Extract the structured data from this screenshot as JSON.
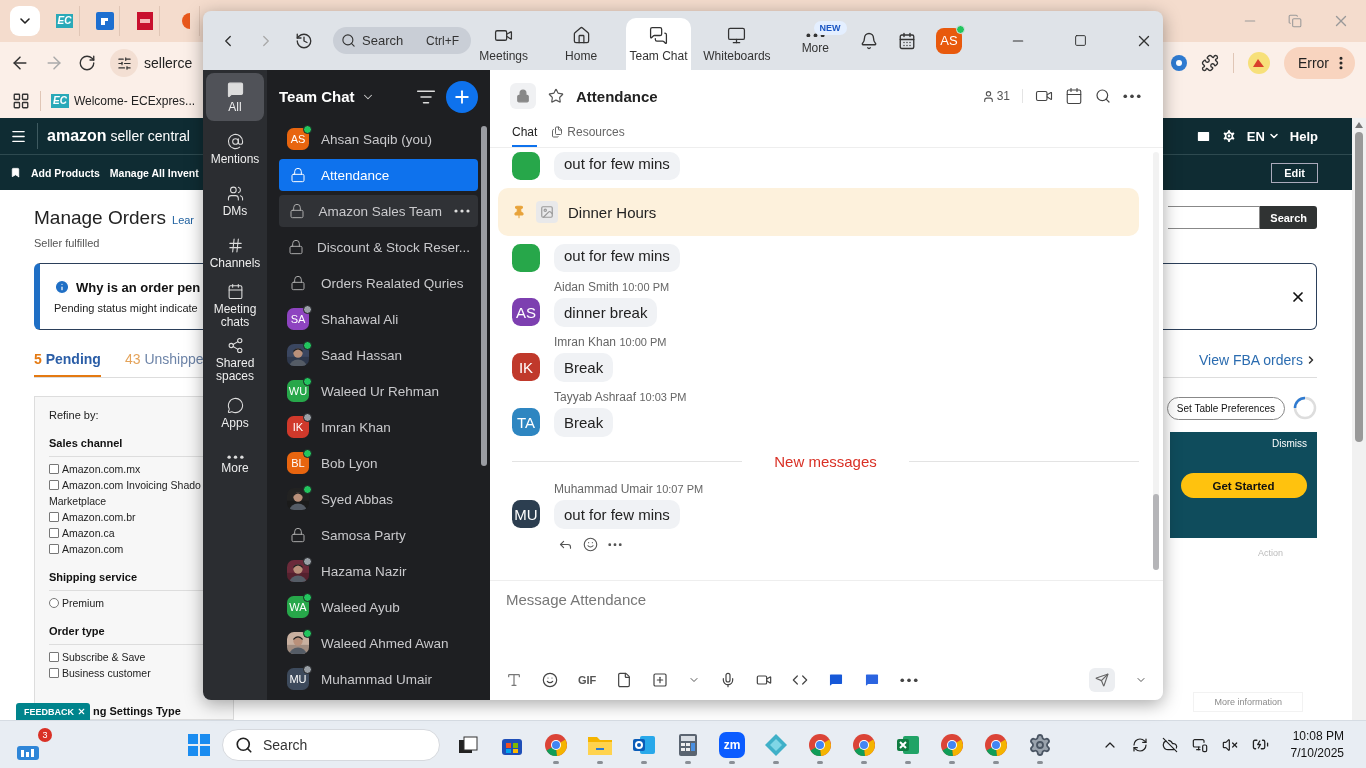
{
  "browser": {
    "tabs": [
      {
        "kind": "ec",
        "label": "EC"
      },
      {
        "kind": "blue"
      },
      {
        "kind": "red"
      },
      {
        "kind": "orange"
      }
    ],
    "address": "sellerce",
    "error_button": "Error",
    "bookmark": {
      "icon": "EC",
      "label": "Welcome- ECExpres..."
    }
  },
  "amazon": {
    "logo": "**amazon** seller central",
    "lang": "EN",
    "help": "Help",
    "subnav": [
      "Add Products",
      "Manage All Invent"
    ],
    "edit": "Edit",
    "title": "Manage Orders",
    "learn": "Lear",
    "subtitle": "Seller fulfilled",
    "search_button": "Search",
    "alert": {
      "title": "Why is an order pen",
      "body": "Pending status might indicate"
    },
    "order_tabs": [
      {
        "count": "5",
        "label": "Pending",
        "selected": true
      },
      {
        "count": "43",
        "label": "Unshippe",
        "selected": false
      }
    ],
    "fba_link": "View FBA orders",
    "refine": {
      "title": "Refine by:",
      "groups": [
        {
          "title": "Sales channel",
          "options": [
            {
              "kind": "checkbox",
              "label": "Amazon.com.mx",
              "checked": false
            },
            {
              "kind": "checkbox",
              "label": "Amazon.com Invoicing Shado",
              "more": "Marketplace",
              "checked": false
            },
            {
              "kind": "checkbox",
              "label": "Amazon.com.br",
              "checked": false
            },
            {
              "kind": "checkbox",
              "label": "Amazon.ca",
              "checked": false
            },
            {
              "kind": "checkbox",
              "label": "Amazon.com",
              "checked": false
            }
          ]
        },
        {
          "title": "Shipping service",
          "options": [
            {
              "kind": "radio",
              "label": "Premium",
              "checked": false
            }
          ]
        },
        {
          "title": "Order type",
          "options": [
            {
              "kind": "checkbox",
              "label": "Subscribe & Save",
              "checked": false
            },
            {
              "kind": "checkbox",
              "label": "Business customer",
              "checked": false
            }
          ]
        }
      ],
      "cut_heading": "ng Settings Type"
    },
    "table_prefs": "Set Table Preferences",
    "promo": {
      "dismiss": "Dismiss",
      "cta": "Get Started"
    },
    "action_header": "Action",
    "more_info": "More information",
    "feedback": "FEEDBACK"
  },
  "zoom": {
    "search": {
      "placeholder": "Search",
      "shortcut": "Ctrl+F"
    },
    "nav": [
      {
        "kind": "meetings",
        "label": "Meetings",
        "selected": false
      },
      {
        "kind": "home",
        "label": "Home",
        "selected": false
      },
      {
        "kind": "chat",
        "label": "Team Chat",
        "selected": true
      },
      {
        "kind": "whiteboards",
        "label": "Whiteboards",
        "selected": false
      },
      {
        "kind": "more",
        "label": "More",
        "selected": false,
        "badge": "NEW"
      }
    ],
    "user": {
      "initials": "AS",
      "online": true
    },
    "rail": [
      {
        "kind": "all",
        "label": "All",
        "selected": true
      },
      {
        "kind": "mentions",
        "label": "Mentions",
        "selected": false
      },
      {
        "kind": "dms",
        "label": "DMs",
        "selected": false
      },
      {
        "kind": "channels",
        "label": "Channels",
        "selected": false
      },
      {
        "kind": "meeting",
        "label": "Meeting chats",
        "selected": false
      },
      {
        "kind": "shared",
        "label": "Shared spaces",
        "selected": false
      },
      {
        "kind": "apps",
        "label": "Apps",
        "selected": false
      },
      {
        "kind": "more",
        "label": "More",
        "selected": false
      }
    ],
    "list_title": "Team Chat",
    "chats": [
      {
        "kind": "person",
        "initials": "AS",
        "color": "#e8650f",
        "online": true,
        "name": "Ahsan Saqib (you)",
        "selected": false,
        "hovered": false
      },
      {
        "kind": "channel",
        "name": "Attendance",
        "selected": true,
        "hovered": false
      },
      {
        "kind": "channel",
        "name": "Amazon Sales Team",
        "selected": false,
        "hovered": true
      },
      {
        "kind": "channel",
        "name": "Discount & Stock Reser...",
        "selected": false,
        "hovered": false
      },
      {
        "kind": "channel",
        "name": "Orders Realated Quries",
        "selected": false,
        "hovered": false
      },
      {
        "kind": "person",
        "initials": "SA",
        "color": "#8e44c0",
        "online": false,
        "name": "Shahawal Ali",
        "selected": false,
        "hovered": false
      },
      {
        "color": "#3a4660",
        "online": true,
        "name": "Saad Hassan",
        "selected": false,
        "hovered": false
      },
      {
        "kind": "person",
        "initials": "WU",
        "color": "#27a74a",
        "online": true,
        "name": "Waleed Ur Rehman",
        "selected": false,
        "hovered": false
      },
      {
        "kind": "person",
        "initials": "IK",
        "color": "#d0392b",
        "online": false,
        "name": "Imran Khan",
        "selected": false,
        "hovered": false
      },
      {
        "kind": "person",
        "initials": "BL",
        "color": "#e8650f",
        "online": true,
        "name": "Bob Lyon",
        "selected": false,
        "hovered": false
      },
      {
        "color": "#222222",
        "online": true,
        "name": "Syed Abbas",
        "selected": false,
        "hovered": false
      },
      {
        "kind": "channel",
        "name": "Samosa Party",
        "selected": false,
        "hovered": false
      },
      {
        "color": "#6b2a3a",
        "online": false,
        "name": "Hazama Nazir",
        "selected": false,
        "hovered": false
      },
      {
        "kind": "person",
        "initials": "WA",
        "color": "#27a74a",
        "online": true,
        "name": "Waleed Ayub",
        "selected": false,
        "hovered": false
      },
      {
        "color": "#c8b0a0",
        "online": true,
        "name": "Waleed Ahmed Awan",
        "selected": false,
        "hovered": false
      },
      {
        "kind": "person",
        "initials": "MU",
        "color": "#3d4a5c",
        "online": false,
        "name": "Muhammad Umair",
        "selected": false,
        "hovered": false
      }
    ],
    "channel": {
      "name": "Attendance",
      "members": "31",
      "tabs": [
        {
          "kind": "chat",
          "label": "Chat",
          "selected": true
        },
        {
          "kind": "resources",
          "label": "Resources",
          "selected": false
        }
      ]
    },
    "messages": [
      {
        "kind": "continued",
        "color": "#27a74a",
        "text": "out for few mins"
      },
      {
        "kind": "pinned",
        "text": "Dinner Hours"
      },
      {
        "kind": "continued",
        "color": "#27a74a",
        "text": "out for few mins"
      },
      {
        "kind": "message",
        "initials": "AS",
        "color": "#7d3fb0",
        "sender": "Aidan Smith",
        "time": "10:00 PM",
        "text": "dinner break"
      },
      {
        "kind": "message",
        "initials": "IK",
        "color": "#c0392b",
        "sender": "Imran Khan",
        "time": "10:00 PM",
        "text": "Break"
      },
      {
        "kind": "message",
        "initials": "TA",
        "color": "#2e86c1",
        "sender": "Tayyab Ashraaf",
        "time": "10:03 PM",
        "text": "Break"
      },
      {
        "kind": "divider",
        "text": "New messages"
      },
      {
        "kind": "message",
        "initials": "MU",
        "color": "#2c3e50",
        "sender": "Muhammad Umair",
        "time": "10:07 PM",
        "text": "out for few mins",
        "actions": true
      }
    ],
    "composer": {
      "placeholder": "Message Attendance",
      "gif": "GIF"
    }
  },
  "taskbar": {
    "widgets_badge": "3",
    "search": "Search",
    "apps": [
      {
        "kind": "taskview",
        "running": false
      },
      {
        "kind": "store",
        "running": false
      },
      {
        "kind": "chrome",
        "running": true
      },
      {
        "kind": "explorer",
        "running": true
      },
      {
        "kind": "outlook",
        "running": true
      },
      {
        "kind": "calculator",
        "running": true
      },
      {
        "kind": "zoom",
        "label": "zm",
        "running": true
      },
      {
        "kind": "diamond",
        "running": true
      },
      {
        "kind": "chrome",
        "running": true
      },
      {
        "kind": "chrome",
        "running": true
      },
      {
        "kind": "excel",
        "running": true
      },
      {
        "kind": "chrome",
        "running": true
      },
      {
        "kind": "chrome",
        "running": true
      },
      {
        "kind": "settings",
        "running": true
      }
    ],
    "time": "10:08 PM",
    "date": "7/10/2025"
  }
}
